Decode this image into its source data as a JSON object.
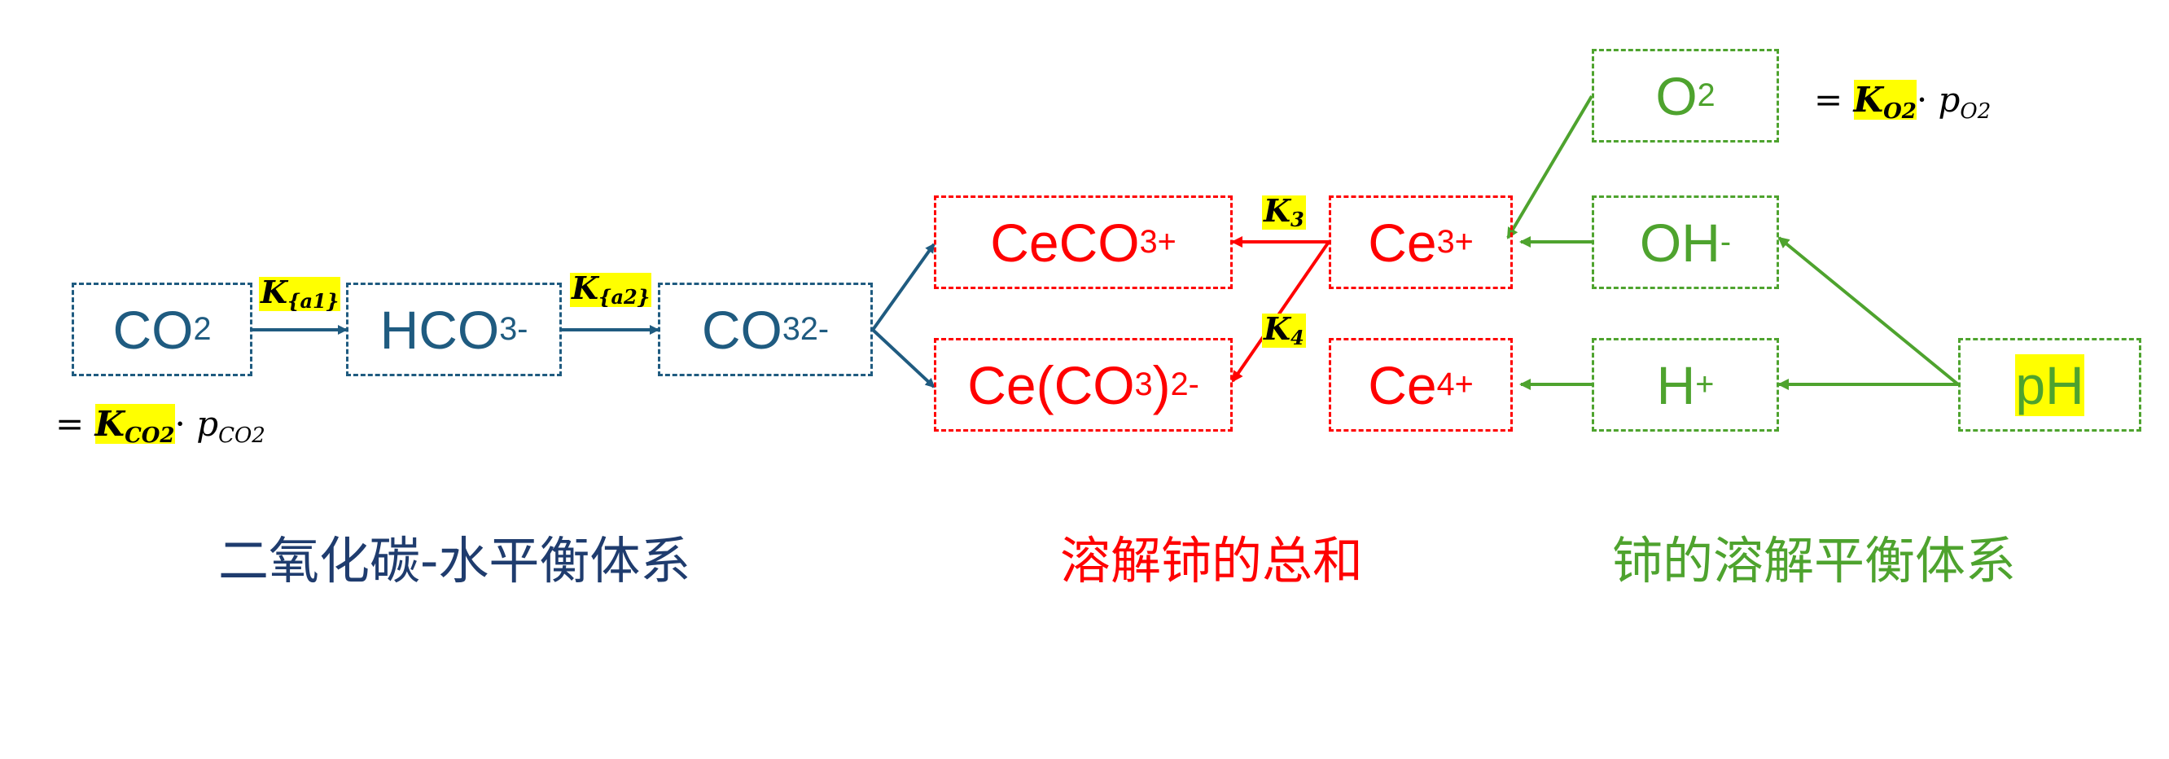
{
  "nodes": {
    "co2": {
      "main": "CO",
      "sub": "2"
    },
    "hco3": {
      "main": "HCO",
      "sub": "3",
      "sup": "-"
    },
    "co3": {
      "main": "CO",
      "sub": "3",
      "sup": "2-"
    },
    "ceco3": {
      "main": "CeCO",
      "sub": "3",
      "sup": "+"
    },
    "ceco3_2": {
      "main": "Ce(CO",
      "sub": "3",
      "after": ")",
      "sub2": "2",
      "sup": "-"
    },
    "ce3": {
      "main": "Ce",
      "sup": "3+"
    },
    "ce4": {
      "main": "Ce",
      "sup": "4+"
    },
    "o2": {
      "main": "O",
      "sub": "2"
    },
    "oh": {
      "main": "OH",
      "sup": "-"
    },
    "h": {
      "main": "H",
      "sup": "+"
    },
    "ph": {
      "main": "pH"
    }
  },
  "constants": {
    "ka1": {
      "k": "K",
      "sub": "{a1}"
    },
    "ka2": {
      "k": "K",
      "sub": "{a2}"
    },
    "k3": {
      "k": "K",
      "sub": "3"
    },
    "k4": {
      "k": "K",
      "sub": "4"
    }
  },
  "equations": {
    "co2": {
      "eq": "= ",
      "k": "K",
      "ksub": "CO2",
      "dot": "· ",
      "p": "p",
      "psub": "CO2"
    },
    "o2": {
      "eq": "= ",
      "k": "K",
      "ksub": "O2",
      "dot": "· ",
      "p": "p",
      "psub": "O2"
    }
  },
  "captions": {
    "blue": "二氧化碳-水平衡体系",
    "red": "溶解铈的总和",
    "green": "铈的溶解平衡体系"
  },
  "colors": {
    "blue": "#1f5b80",
    "red": "#ff0000",
    "green": "#4ea32e",
    "highlight": "#ffff00"
  }
}
